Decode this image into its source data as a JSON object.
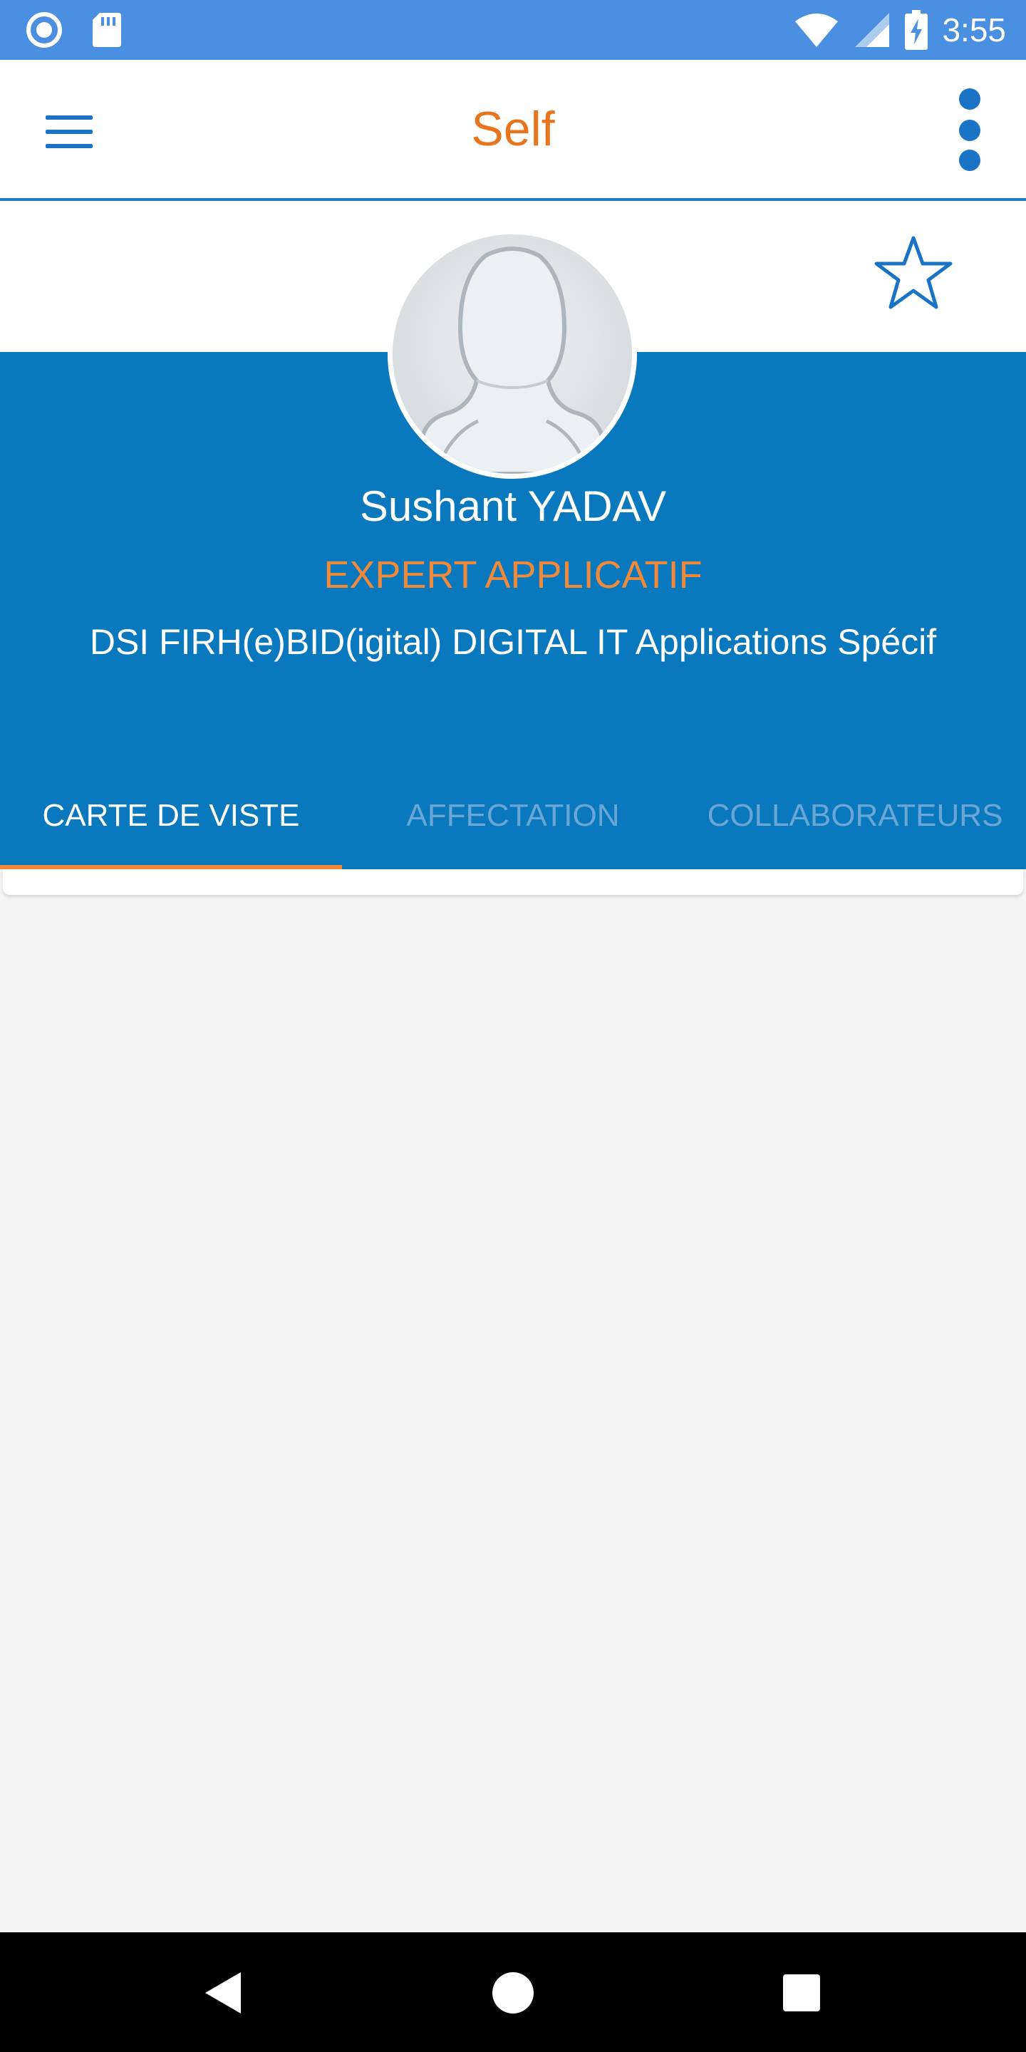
{
  "status_bar": {
    "time": "3:55",
    "icons": [
      "notification-circle-icon",
      "sd-card-icon",
      "wifi-icon",
      "signal-icon",
      "battery-charging-icon"
    ]
  },
  "app_bar": {
    "title": "Self",
    "menu_icon": "hamburger-menu-icon",
    "more_icon": "more-vertical-icon"
  },
  "profile": {
    "name": "Sushant YADAV",
    "job_title": "EXPERT APPLICATIF",
    "department": "DSI FIRH(e)BID(igital)  DIGITAL IT Applications Spécif",
    "favorite_icon": "star-outline-icon",
    "avatar_icon": "default-avatar-silhouette"
  },
  "tabs": [
    {
      "label": "CARTE DE VISTE",
      "active": true
    },
    {
      "label": "AFFECTATION",
      "active": false
    },
    {
      "label": "COLLABORATEURS",
      "active": false
    }
  ],
  "nav_bar": {
    "icons": [
      "back-triangle-icon",
      "home-circle-icon",
      "recents-square-icon"
    ]
  },
  "colors": {
    "status_bar": "#4a8fe0",
    "primary_blue": "#0a78bd",
    "accent_orange": "#e8741e",
    "inactive_tab": "#6aa6d6",
    "background": "#f4f4f4"
  }
}
